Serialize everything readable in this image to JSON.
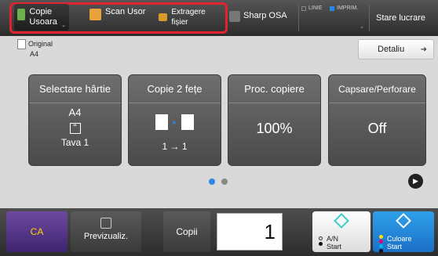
{
  "topbar": {
    "quick_buttons": [
      {
        "label": "Copie Usoara",
        "icon": "copy-icon"
      },
      {
        "label": "Scan Usor",
        "icon": "scan-icon"
      },
      {
        "label": "Extragere fișier",
        "icon": "folder-icon"
      }
    ],
    "osa_label": "Sharp OSA",
    "line_label": "LINIE",
    "print_label": "IMPRIM.",
    "jobs_label": "Stare lucrare"
  },
  "main": {
    "original_label": "Original",
    "original_value": "A4",
    "detail_label": "Detaliu",
    "cards": [
      {
        "head": "Selectare hârtie",
        "top": "A4",
        "bottom": "Tava 1"
      },
      {
        "head": "Copie 2 fețe",
        "bottom": "1 → 1"
      },
      {
        "head": "Proc. copiere",
        "big": "100%"
      },
      {
        "head": "Capsare/Perforare",
        "big": "Off"
      }
    ]
  },
  "bottom": {
    "ca_label": "CA",
    "preview_label": "Previzualiz.",
    "copies_label": "Copii",
    "copies_value": "1",
    "bw_label1": "A/N",
    "bw_label2": "Start",
    "color_label1": "Culoare",
    "color_label2": "Start"
  },
  "colors": {
    "accent_blue": "#2a88e5",
    "highlight_red": "#e0232e",
    "ca_purple": "#4e2c82",
    "ca_text": "#ffd400"
  }
}
